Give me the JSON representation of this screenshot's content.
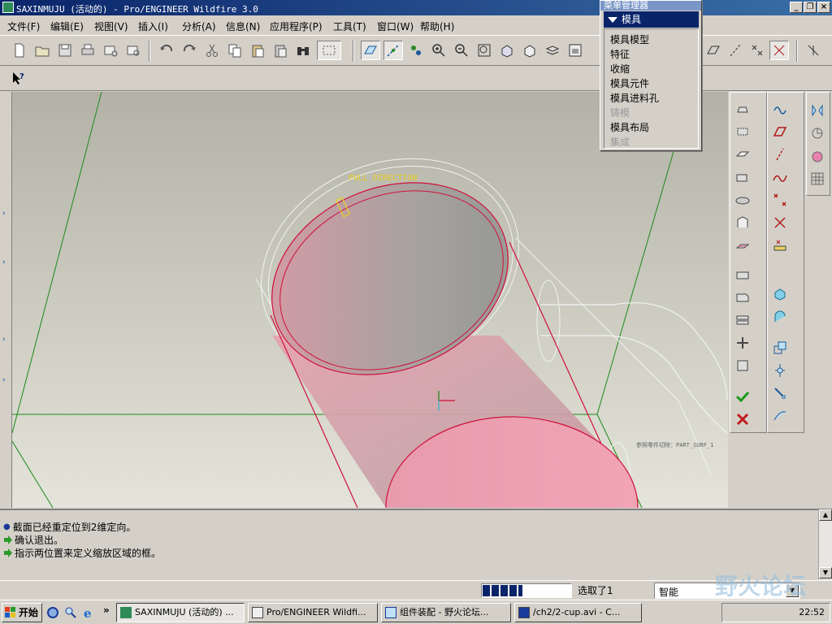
{
  "window": {
    "title": "SAXINMUJU (活动的) - Pro/ENGINEER Wildfire 3.0"
  },
  "menubar": {
    "items": [
      "文件(F)",
      "编辑(E)",
      "视图(V)",
      "插入(I)",
      "分析(A)",
      "信息(N)",
      "应用程序(P)",
      "工具(T)",
      "窗口(W)",
      "帮助(H)"
    ]
  },
  "menu_manager": {
    "title": "菜单管理器",
    "selected": "模具",
    "items": [
      {
        "label": "模具模型",
        "enabled": true
      },
      {
        "label": "特征",
        "enabled": true
      },
      {
        "label": "收缩",
        "enabled": true
      },
      {
        "label": "模具元件",
        "enabled": true
      },
      {
        "label": "模具进料孔",
        "enabled": true
      },
      {
        "label": "铸模",
        "enabled": false
      },
      {
        "label": "模具布局",
        "enabled": true
      },
      {
        "label": "集成",
        "enabled": false
      }
    ]
  },
  "viewport": {
    "annotation_pull": "PULL DIRECTION",
    "annotation_part": "参照零件切除：PART_SURF_1",
    "colors": {
      "body": "#e58ca0",
      "edge": "#d0103a",
      "datum": "#1a8a1a",
      "background": "#b8b8ac"
    }
  },
  "messages": [
    {
      "icon": "bullet-icon",
      "text": "截面已经重定位到2维定向。"
    },
    {
      "icon": "arrow-icon",
      "text": "确认退出。"
    },
    {
      "icon": "arrow-icon",
      "text": "指示两位置来定义缩放区域的框。"
    }
  ],
  "status": {
    "progress": 0.45,
    "selection": "选取了1",
    "filter": "智能"
  },
  "taskbar": {
    "start": "开始",
    "tasks": [
      "SAXINMUJU (活动的) ...",
      "Pro/ENGINEER Wildfi...",
      "组件装配 - 野火论坛...",
      "/ch2/2-cup.avi - C..."
    ],
    "clock": "22:52"
  },
  "watermark": "野火论坛"
}
